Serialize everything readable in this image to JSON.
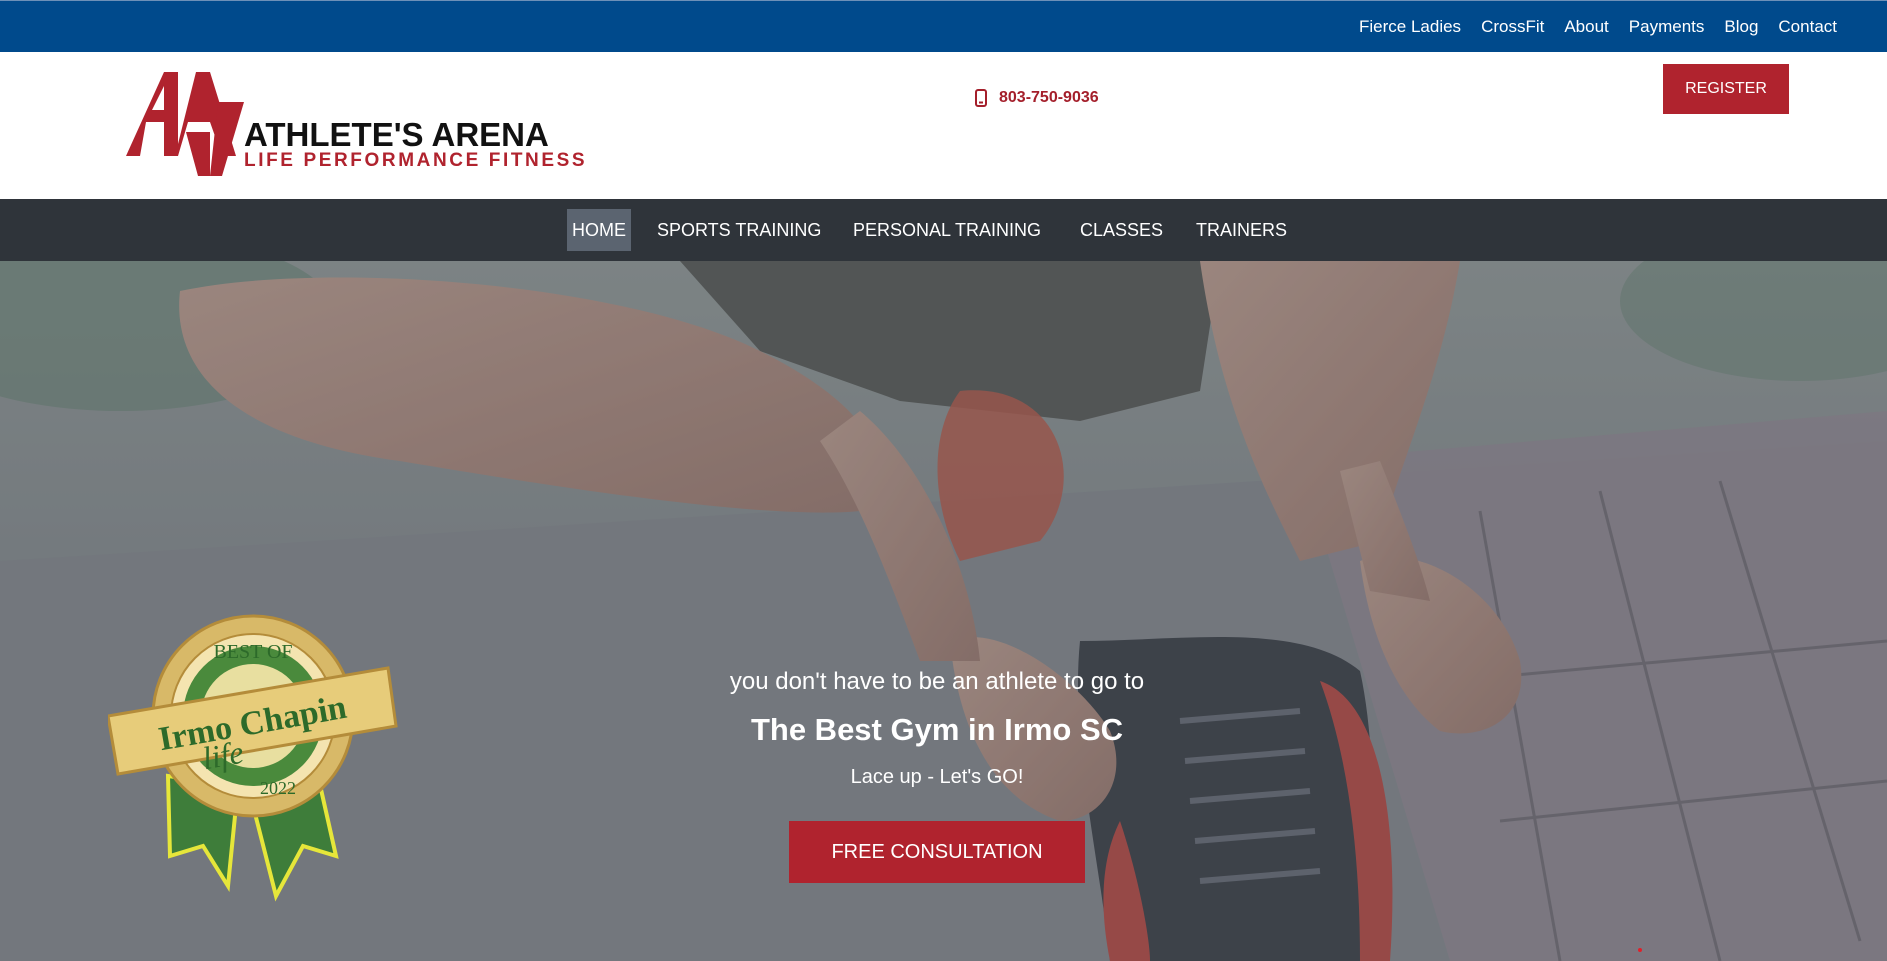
{
  "topbar": {
    "links": [
      "Fierce Ladies",
      "CrossFit",
      "About",
      "Payments",
      "Blog",
      "Contact"
    ]
  },
  "header": {
    "logo_title": "ATHLETE'S ARENA",
    "logo_subtitle": "LIFE PERFORMANCE FITNESS",
    "phone": "803-750-9036",
    "register_label": "REGISTER"
  },
  "nav": {
    "items": [
      "HOME",
      "SPORTS TRAINING",
      "PERSONAL TRAINING",
      "CLASSES",
      "TRAINERS"
    ],
    "active": "HOME"
  },
  "badge": {
    "line1": "BEST OF",
    "line2": "Irmo Chapin",
    "line3": "life",
    "year": "2022"
  },
  "hero": {
    "pre_title": "you don't have to be an athlete to go to",
    "title": "The Best Gym in Irmo SC",
    "subtitle": "Lace up - Let's GO!",
    "cta_label": "FREE CONSULTATION"
  },
  "colors": {
    "topbar": "#004a8c",
    "brand_red": "#b0232e",
    "nav_bg": "#2f343a",
    "nav_active": "#5b6470"
  }
}
